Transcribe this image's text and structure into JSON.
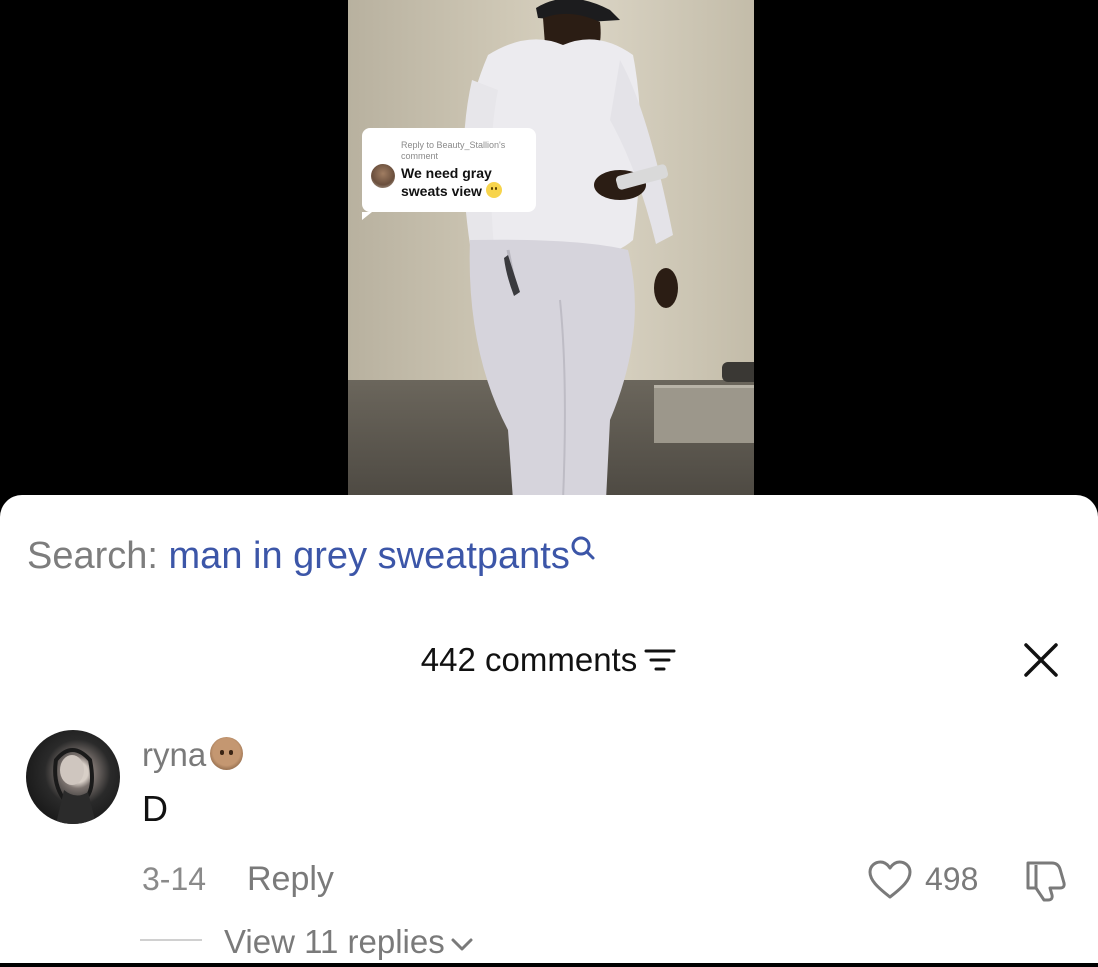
{
  "video": {
    "reply_bubble": {
      "subtitle": "Reply to Beauty_Stallion's comment",
      "text": "We need gray sweats view"
    }
  },
  "search": {
    "prefix": "Search:",
    "query": "man in grey sweatpants",
    "icon": "search-icon"
  },
  "comments": {
    "count_label": "442 comments",
    "filter_icon": "filter-icon",
    "close_icon": "close-icon"
  },
  "comment": {
    "username": "ryna",
    "text": "D",
    "date": "3-14",
    "reply_label": "Reply",
    "likes": "498",
    "view_replies_label": "View 11 replies"
  },
  "colors": {
    "search_query": "#3c56a8",
    "muted_text": "#7a7a7a",
    "sheet_bg": "#ffffff"
  }
}
